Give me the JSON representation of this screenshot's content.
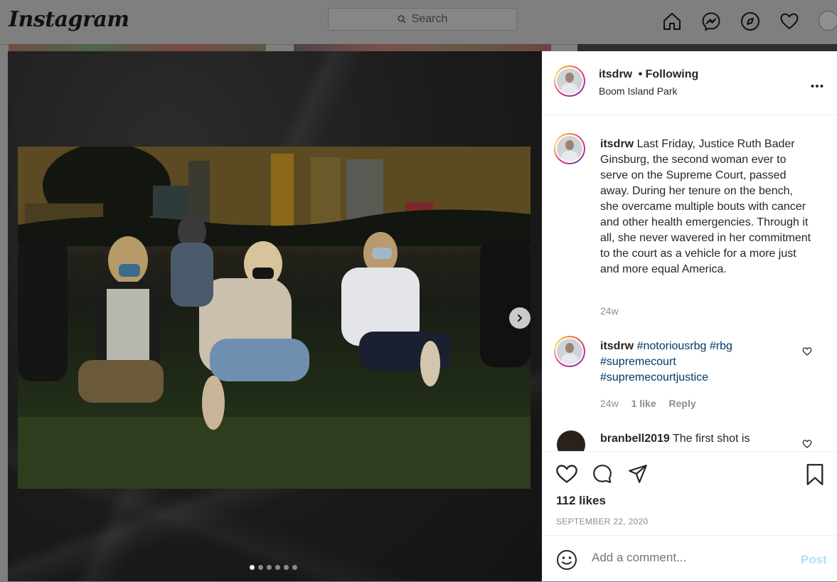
{
  "nav": {
    "logo": "Instagram",
    "search_placeholder": "Search"
  },
  "post": {
    "username": "itsdrw",
    "following_label": "• Following",
    "location": "Boom Island Park",
    "more_label": "•••",
    "carousel_count": 6,
    "carousel_active": 0
  },
  "comments": [
    {
      "username": "itsdrw",
      "text": "Last Friday, Justice Ruth Bader Ginsburg, the second woman ever to serve on the Supreme Court, passed away.  During her tenure on the bench, she overcame multiple bouts with cancer and other health emergencies. Through it all, she never wavered in her commitment to the court as a vehicle for a more just and more equal America.",
      "time": "24w"
    },
    {
      "username": "itsdrw",
      "tags": [
        "#notoriousrbg",
        "#rbg",
        "#supremecourt",
        "#supremecourtjustice"
      ],
      "time": "24w",
      "likes": "1 like",
      "reply": "Reply"
    },
    {
      "username": "branbell2019",
      "text": "The first shot is"
    }
  ],
  "actions": {
    "likes": "112 likes",
    "date": "SEPTEMBER 22, 2020"
  },
  "add_comment": {
    "placeholder": "Add a comment...",
    "post_label": "Post"
  }
}
